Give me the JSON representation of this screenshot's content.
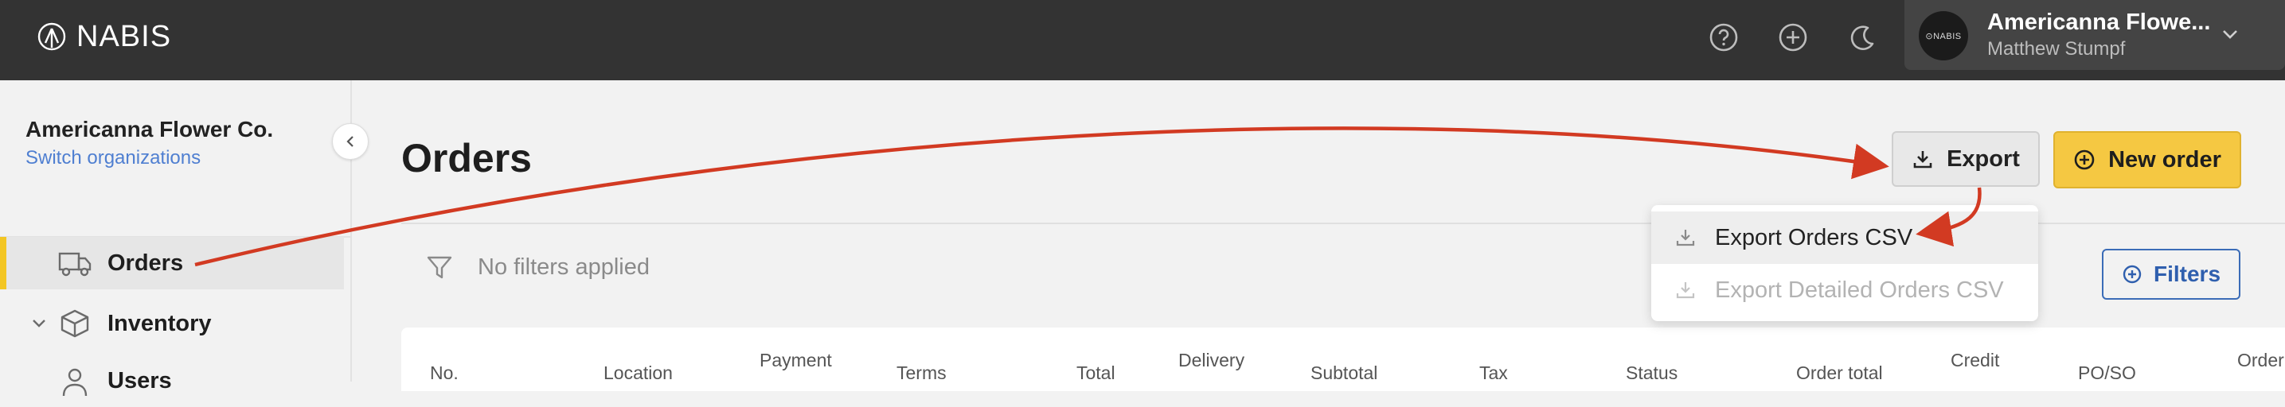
{
  "app": {
    "brand": "NABIS"
  },
  "topbar": {
    "icons": [
      "help-circle-icon",
      "plus-circle-icon",
      "moon-icon"
    ],
    "org_name": "Americanna Flowe...",
    "user_name": "Matthew Stumpf",
    "avatar_text": "⊙NABIS"
  },
  "sidebar": {
    "org_name": "Americanna Flower Co.",
    "switch_label": "Switch organizations",
    "items": [
      {
        "label": "Orders",
        "icon": "truck-icon",
        "active": true
      },
      {
        "label": "Inventory",
        "icon": "box-icon",
        "active": false
      },
      {
        "label": "Users",
        "icon": "user-icon",
        "active": false
      }
    ]
  },
  "main": {
    "title": "Orders",
    "export_label": "Export",
    "new_order_label": "New order",
    "filter_text": "No filters applied",
    "filters_label": "Filters",
    "export_menu": [
      {
        "label": "Export Orders CSV",
        "state": "hover"
      },
      {
        "label": "Export Detailed Orders CSV",
        "state": "disabled"
      }
    ],
    "table_headers": [
      {
        "label": "No."
      },
      {
        "label": "Location"
      },
      {
        "label": "Payment"
      },
      {
        "label": "Terms"
      },
      {
        "label": "Total"
      },
      {
        "label": "Delivery"
      },
      {
        "label": "Subtotal"
      },
      {
        "label": "Tax"
      },
      {
        "label": "Status"
      },
      {
        "label": "Order total"
      },
      {
        "label": "Credit"
      },
      {
        "label": "PO/SO"
      },
      {
        "label": "Order"
      }
    ]
  },
  "colors": {
    "topbar": "#333333",
    "accent_yellow": "#f5c842",
    "link_blue": "#4f7fd1",
    "filters_blue": "#2f5fae",
    "annotation_red": "#d23a22"
  }
}
